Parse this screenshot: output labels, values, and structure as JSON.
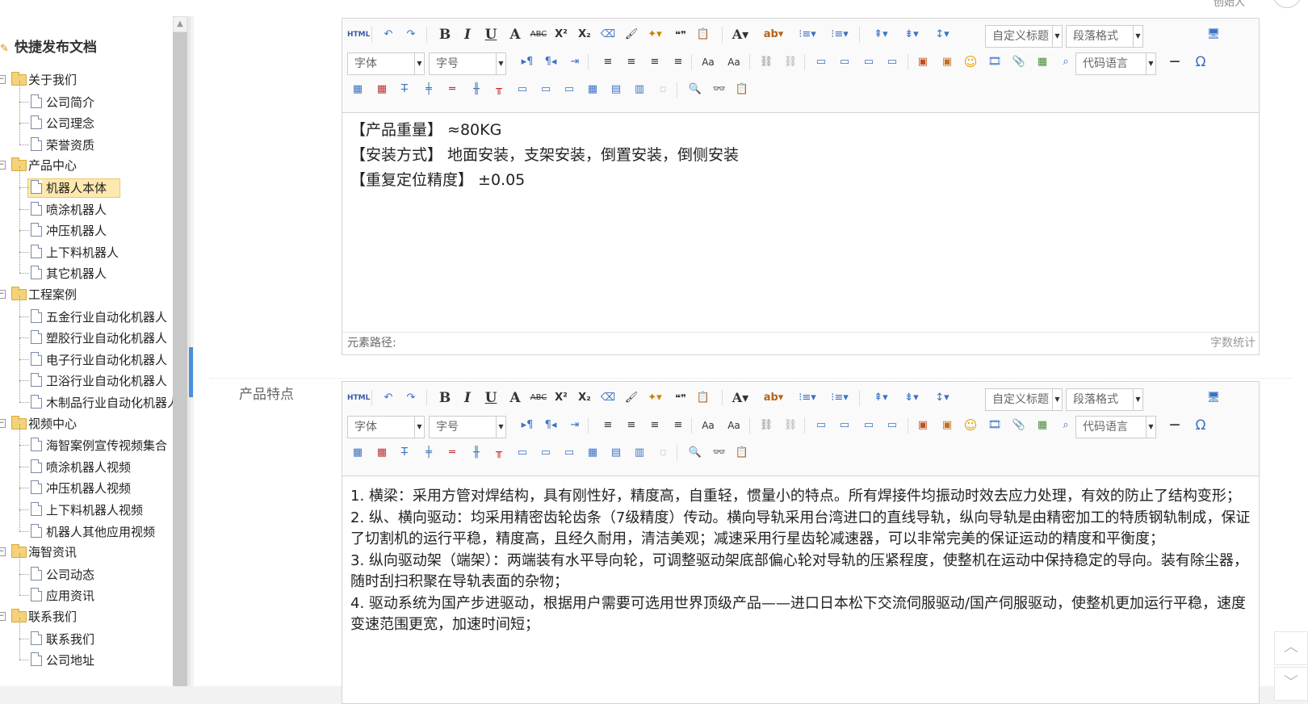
{
  "header": {
    "user_text": "创始人"
  },
  "sidebar": {
    "title": "快捷发布文档",
    "categories": [
      {
        "label": "关于我们",
        "children": [
          "公司简介",
          "公司理念",
          "荣誉资质"
        ]
      },
      {
        "label": "产品中心",
        "children": [
          "机器人本体",
          "喷涂机器人",
          "冲压机器人",
          "上下料机器人",
          "其它机器人"
        ]
      },
      {
        "label": "工程案例",
        "children": [
          "五金行业自动化机器人",
          "塑胶行业自动化机器人",
          "电子行业自动化机器人",
          "卫浴行业自动化机器人",
          "木制品行业自动化机器人"
        ]
      },
      {
        "label": "视频中心",
        "children": [
          "海智案例宣传视频集合",
          "喷涂机器人视频",
          "冲压机器人视频",
          "上下料机器人视频",
          "机器人其他应用视频"
        ]
      },
      {
        "label": "海智资讯",
        "children": [
          "公司动态",
          "应用资讯"
        ]
      },
      {
        "label": "联系我们",
        "children": [
          "联系我们",
          "公司地址"
        ]
      }
    ],
    "selected": "机器人本体",
    "expand_symbol": "−"
  },
  "toolbar": {
    "html_label": "HTML",
    "bold": "B",
    "italic": "I",
    "underline": "U",
    "font_color": "A",
    "strike": "ABC",
    "sup": "X²",
    "sub": "X₂",
    "quote": "❝❞",
    "font_select": "字体",
    "size_select": "字号",
    "custom_heading": "自定义标题",
    "paragraph_format": "段落格式",
    "code_language": "代码语言",
    "omega": "Ω",
    "hr": "—"
  },
  "editor1": {
    "lines": [
      "【产品重量】  ≈80KG",
      "【安装方式】  地面安装，支架安装，倒置安装，倒侧安装",
      "【重复定位精度】   ±0.05"
    ],
    "status_path": "元素路径:",
    "word_count": "字数统计"
  },
  "editor2": {
    "label": "产品特点",
    "lines": [
      "1. 横梁：采用方管对焊结构，具有刚性好，精度高，自重轻，惯量小的特点。所有焊接件均振动时效去应力处理，有效的防止了结构变形；",
      "2. 纵、横向驱动：均采用精密齿轮齿条（7级精度）传动。横向导轨采用台湾进口的直线导轨，纵向导轨是由精密加工的特质钢轨制成，保证了切割机的运行平稳，精度高，且经久耐用，清洁美观；减速采用行星齿轮减速器，可以非常完美的保证运动的精度和平衡度；",
      "3. 纵向驱动架（端架）：两端装有水平导向轮，可调整驱动架底部偏心轮对导轨的压紧程度，使整机在运动中保持稳定的导向。装有除尘器，随时刮扫积聚在导轨表面的杂物；",
      "4. 驱动系统为国产步进驱动，根据用户需要可选用世界顶级产品——进口日本松下交流伺服驱动/国产伺服驱动，使整机更加运行平稳，速度变速范围更宽，加速时间短；"
    ]
  }
}
